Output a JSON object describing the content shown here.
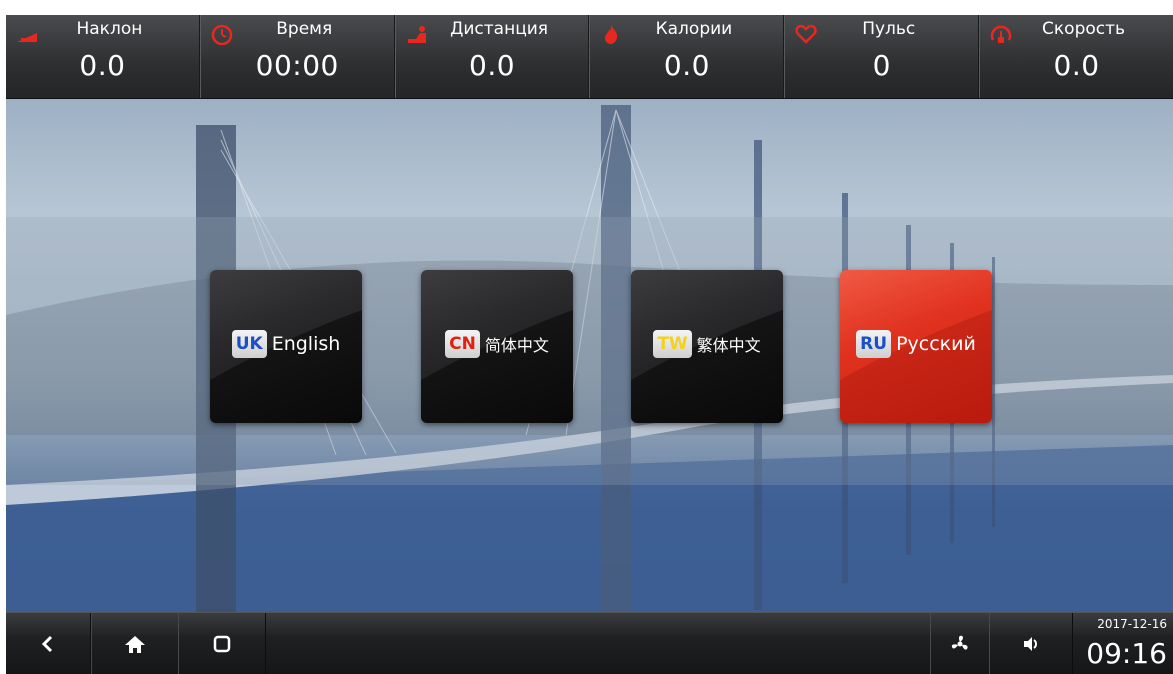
{
  "stats": [
    {
      "label": "Наклон",
      "value": "0.0",
      "icon": "incline-icon"
    },
    {
      "label": "Время",
      "value": "00:00",
      "icon": "clock-icon"
    },
    {
      "label": "Дистанция",
      "value": "0.0",
      "icon": "runner-icon"
    },
    {
      "label": "Калории",
      "value": "0.0",
      "icon": "flame-icon"
    },
    {
      "label": "Пульс",
      "value": "0",
      "icon": "heart-icon"
    },
    {
      "label": "Скорость",
      "value": "0.0",
      "icon": "speedometer-icon"
    }
  ],
  "languages": [
    {
      "code": "UK",
      "name": "English",
      "code_color": "#1a4fc8",
      "selected": false
    },
    {
      "code": "CN",
      "name": "简体中文",
      "code_color": "#e02010",
      "selected": false
    },
    {
      "code": "TW",
      "name": "繁体中文",
      "code_color": "#f2d21b",
      "selected": false
    },
    {
      "code": "RU",
      "name": "Русский",
      "code_color": "#1a4fc8",
      "selected": true
    }
  ],
  "navbar": {
    "back_icon": "back-icon",
    "home_icon": "home-icon",
    "recents_icon": "recents-icon",
    "fan_icon": "fan-icon",
    "volume_icon": "volume-icon",
    "date": "2017-12-16",
    "time": "09:16"
  },
  "colors": {
    "accent_red": "#e0321f",
    "icon_red": "#e8281e",
    "bar_dark": "#2e2f31"
  }
}
